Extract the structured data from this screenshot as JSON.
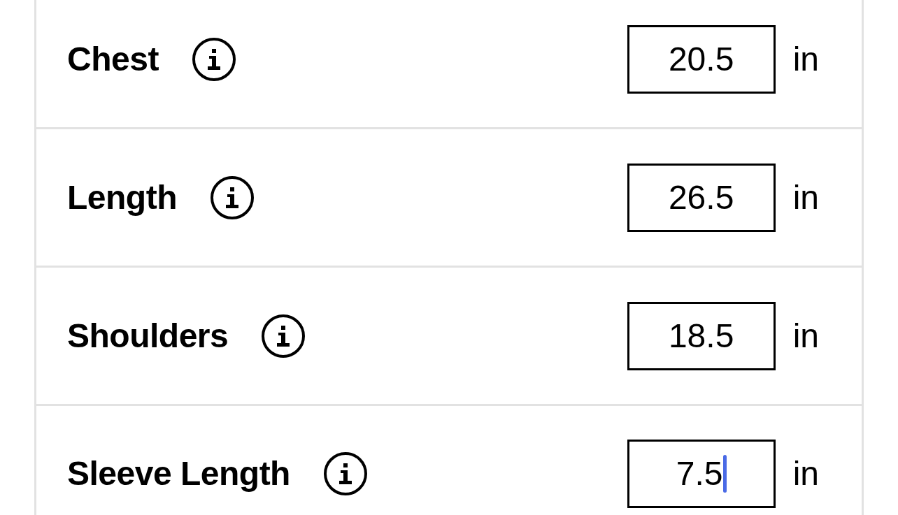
{
  "rows": [
    {
      "label": "Chest",
      "value": "20.5",
      "unit": "in",
      "focused": false
    },
    {
      "label": "Length",
      "value": "26.5",
      "unit": "in",
      "focused": false
    },
    {
      "label": "Shoulders",
      "value": "18.5",
      "unit": "in",
      "focused": false
    },
    {
      "label": "Sleeve Length",
      "value": "7.5",
      "unit": "in",
      "focused": true
    }
  ]
}
